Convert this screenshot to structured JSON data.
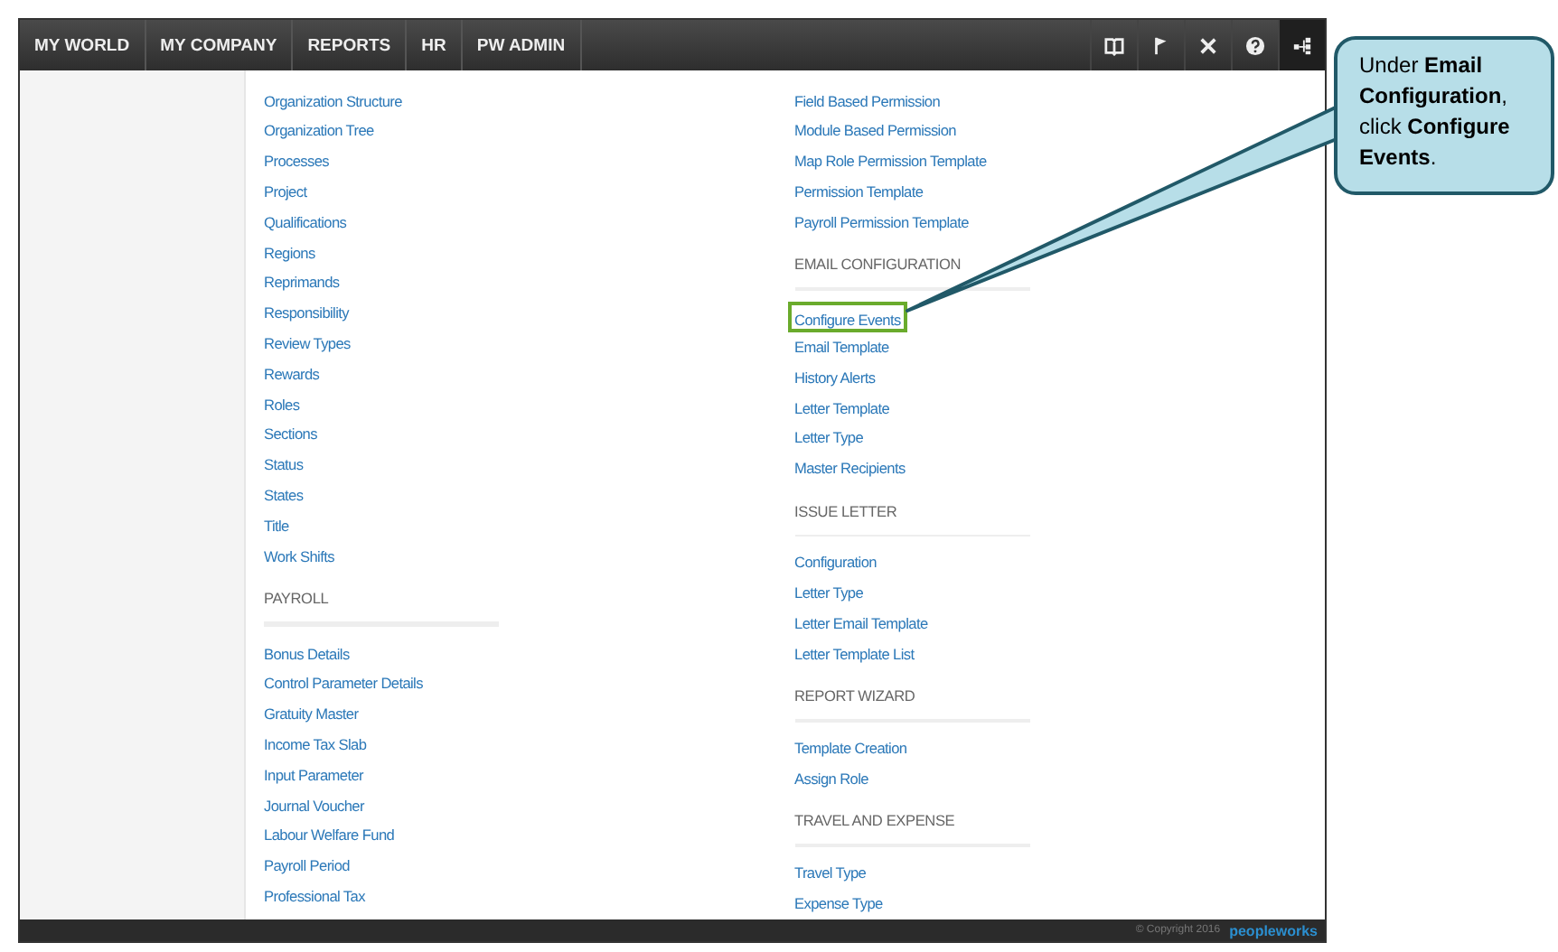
{
  "nav": {
    "items": [
      "MY WORLD",
      "MY COMPANY",
      "REPORTS",
      "HR",
      "PW ADMIN"
    ]
  },
  "columns": [
    {
      "groups": [
        {
          "items": [
            {
              "label": "Organization Structure",
              "highlighted": false
            },
            {
              "label": "Organization Tree",
              "highlighted": false
            },
            {
              "label": "Processes",
              "highlighted": false
            },
            {
              "label": "Project",
              "highlighted": false
            },
            {
              "label": "Qualifications",
              "highlighted": false
            },
            {
              "label": "Regions",
              "highlighted": false
            },
            {
              "label": "Reprimands",
              "highlighted": false
            },
            {
              "label": "Responsibility",
              "highlighted": false
            },
            {
              "label": "Review Types",
              "highlighted": false
            },
            {
              "label": "Rewards",
              "highlighted": false
            },
            {
              "label": "Roles",
              "highlighted": false
            },
            {
              "label": "Sections",
              "highlighted": false
            },
            {
              "label": "Status",
              "highlighted": false
            },
            {
              "label": "States",
              "highlighted": false
            },
            {
              "label": "Title",
              "highlighted": false
            },
            {
              "label": "Work Shifts",
              "highlighted": false
            }
          ]
        },
        {
          "heading": "PAYROLL",
          "items": [
            {
              "label": "Bonus Details",
              "highlighted": false
            },
            {
              "label": "Control Parameter Details",
              "highlighted": false
            },
            {
              "label": "Gratuity Master",
              "highlighted": false
            },
            {
              "label": "Income Tax Slab",
              "highlighted": false
            },
            {
              "label": "Input Parameter",
              "highlighted": false
            },
            {
              "label": "Journal Voucher",
              "highlighted": false
            },
            {
              "label": "Labour Welfare Fund",
              "highlighted": false
            },
            {
              "label": "Payroll Period",
              "highlighted": false
            },
            {
              "label": "Professional Tax",
              "highlighted": false
            }
          ]
        }
      ]
    },
    {
      "groups": [
        {
          "items": [
            {
              "label": "Field Based Permission",
              "highlighted": false
            },
            {
              "label": "Module Based Permission",
              "highlighted": false
            },
            {
              "label": "Map Role Permission Template",
              "highlighted": false
            },
            {
              "label": "Permission Template",
              "highlighted": false
            },
            {
              "label": "Payroll Permission Template",
              "highlighted": false
            }
          ]
        },
        {
          "heading": "EMAIL CONFIGURATION",
          "items": [
            {
              "label": "Configure Events",
              "highlighted": true
            },
            {
              "label": "Email Template",
              "highlighted": false
            },
            {
              "label": "History Alerts",
              "highlighted": false
            },
            {
              "label": "Letter Template",
              "highlighted": false
            },
            {
              "label": "Letter Type",
              "highlighted": false
            },
            {
              "label": "Master Recipients",
              "highlighted": false
            }
          ]
        },
        {
          "heading": "ISSUE LETTER",
          "items": [
            {
              "label": "Configuration",
              "highlighted": false
            },
            {
              "label": "Letter Type",
              "highlighted": false
            },
            {
              "label": "Letter Email Template",
              "highlighted": false
            },
            {
              "label": "Letter Template List",
              "highlighted": false
            }
          ]
        },
        {
          "heading": "REPORT WIZARD",
          "items": [
            {
              "label": "Template Creation",
              "highlighted": false
            },
            {
              "label": "Assign Role",
              "highlighted": false
            }
          ]
        },
        {
          "heading": "TRAVEL AND EXPENSE",
          "items": [
            {
              "label": "Travel Type",
              "highlighted": false
            },
            {
              "label": "Expense Type",
              "highlighted": false
            }
          ]
        }
      ]
    }
  ],
  "footer": {
    "copyright": "© Copyright 2016",
    "logo": "peopleworks"
  },
  "callout": {
    "text": "Under **Email Configuration**, click **Configure Events**."
  }
}
